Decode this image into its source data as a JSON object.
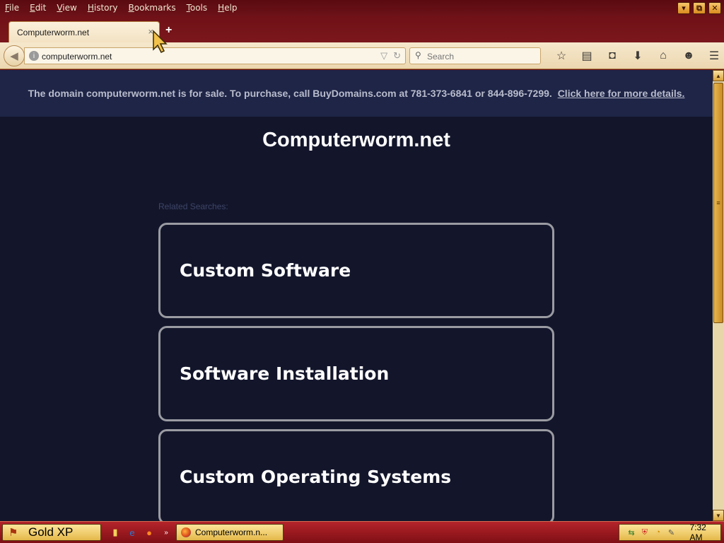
{
  "menubar": {
    "items": [
      "File",
      "Edit",
      "View",
      "History",
      "Bookmarks",
      "Tools",
      "Help"
    ],
    "window_buttons": [
      "minimize-icon",
      "restore-icon",
      "close-icon"
    ]
  },
  "tab": {
    "title": "Computerworm.net",
    "close_glyph": "×",
    "new_tab_glyph": "+"
  },
  "navbar": {
    "url": "computerworm.net",
    "search_placeholder": "Search",
    "toolbar_icons": [
      "bookmark-star-icon",
      "reading-list-icon",
      "pocket-icon",
      "download-icon",
      "home-icon",
      "hello-chat-icon",
      "menu-icon"
    ]
  },
  "page": {
    "banner_text": "The domain computerworm.net is for sale. To purchase, call BuyDomains.com at 781-373-6841 or 844-896-7299.",
    "banner_link": "Click here for more details.",
    "title": "Computerworm.net",
    "related_label": "Related Searches:",
    "results": [
      "Custom Software",
      "Software Installation",
      "Custom Operating Systems"
    ]
  },
  "taskbar": {
    "start_label": "Gold XP",
    "task_label": "Computerworm.n...",
    "clock": "7:32 AM"
  },
  "colors": {
    "page_bg": "#13162b",
    "banner_bg": "#1e2547",
    "chrome_dark": "#6b0f14",
    "gold": "#e5b84a"
  }
}
